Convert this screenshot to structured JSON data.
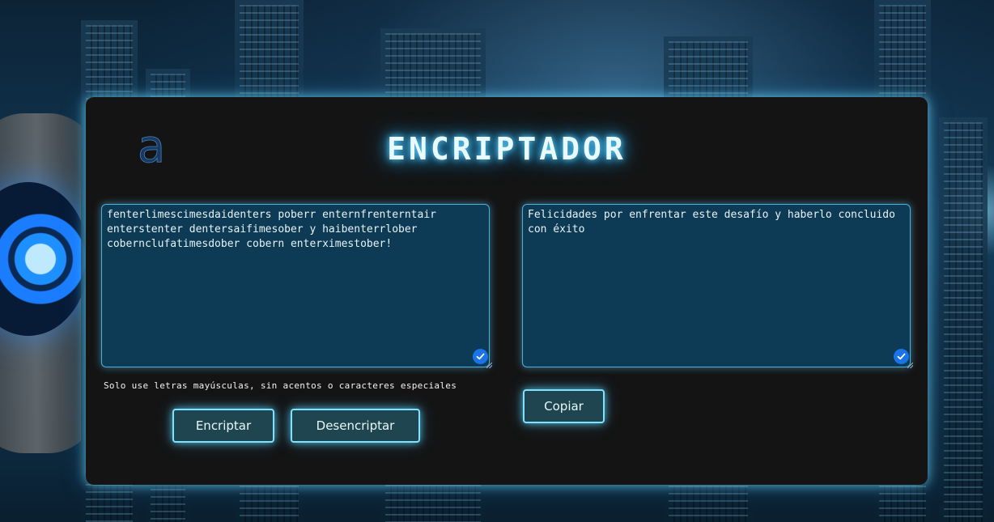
{
  "app": {
    "title": "ENCRIPTADOR",
    "logo_letter": "a"
  },
  "input": {
    "value": "fenterlimescimesdaidenters poberr enternfrenterntair enterstenter dentersaifimesober y haibenterrlober cobernclufatimesdober cobern enterximestober!",
    "hint": "Solo use letras mayúsculas, sin acentos o caracteres especiales"
  },
  "output": {
    "value": "Felicidades por enfrentar este desafío y haberlo concluido con éxito"
  },
  "buttons": {
    "encrypt": "Encriptar",
    "decrypt": "Desencriptar",
    "copy": "Copiar"
  },
  "colors": {
    "panel": "#141414",
    "textbox": "#0d3a54",
    "glow": "#7de3ff",
    "check": "#1a73e8"
  }
}
